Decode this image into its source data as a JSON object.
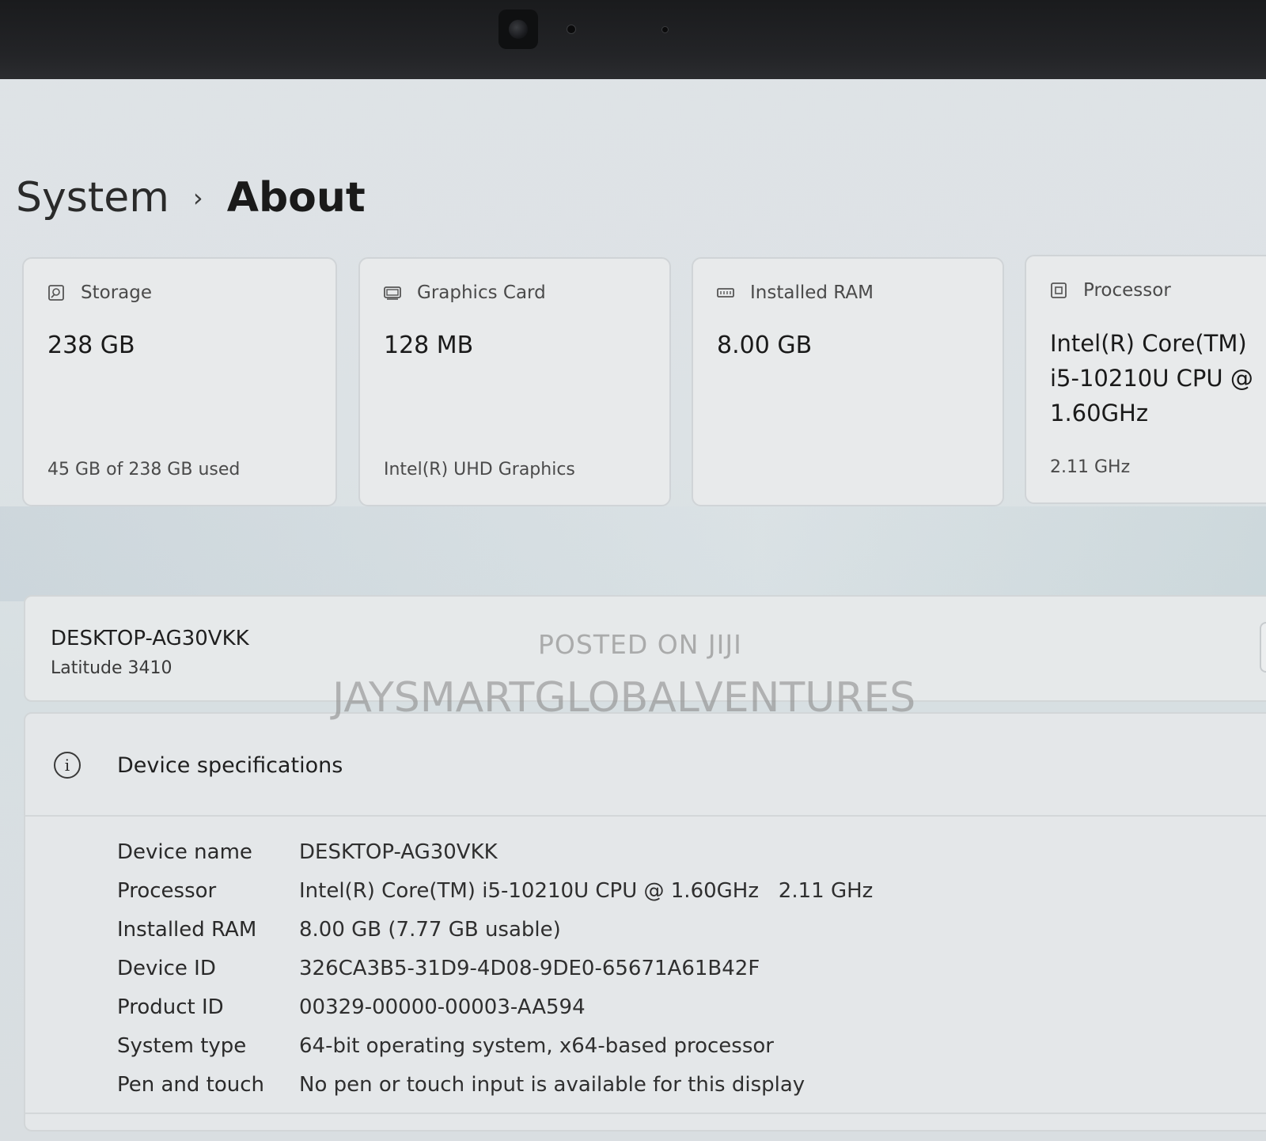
{
  "breadcrumb": {
    "parent": "System",
    "separator": "›",
    "current": "About"
  },
  "cards": [
    {
      "title": "Storage",
      "icon": "storage-icon",
      "value": "238 GB",
      "sub": "45 GB of 238 GB used"
    },
    {
      "title": "Graphics Card",
      "icon": "graphics-card-icon",
      "value": "128 MB",
      "sub": "Intel(R) UHD Graphics"
    },
    {
      "title": "Installed RAM",
      "icon": "ram-icon",
      "value": "8.00 GB",
      "sub": ""
    },
    {
      "title": "Processor",
      "icon": "processor-icon",
      "value": "Intel(R) Core(TM) i5-10210U CPU @ 1.60GHz",
      "sub": "2.11 GHz"
    }
  ],
  "device": {
    "name": "DESKTOP-AG30VKK",
    "model": "Latitude 3410"
  },
  "watermark": {
    "line1": "POSTED ON JIJI",
    "line2": "JAYSMARTGLOBALVENTURES"
  },
  "specs": {
    "title": "Device specifications",
    "rows": [
      {
        "label": "Device name",
        "value": "DESKTOP-AG30VKK"
      },
      {
        "label": "Processor",
        "value": "Intel(R) Core(TM) i5-10210U CPU @ 1.60GHz   2.11 GHz"
      },
      {
        "label": "Installed RAM",
        "value": "8.00 GB (7.77 GB usable)"
      },
      {
        "label": "Device ID",
        "value": "326CA3B5-31D9-4D08-9DE0-65671A61B42F"
      },
      {
        "label": "Product ID",
        "value": "00329-00000-00003-AA594"
      },
      {
        "label": "System type",
        "value": "64-bit operating system, x64-based processor"
      },
      {
        "label": "Pen and touch",
        "value": "No pen or touch input is available for this display"
      }
    ]
  },
  "colors": {
    "background": "#dfe3e6",
    "bezel": "#1a1b1d",
    "card": "#e8eaeb",
    "text": "#1a1a1a"
  }
}
